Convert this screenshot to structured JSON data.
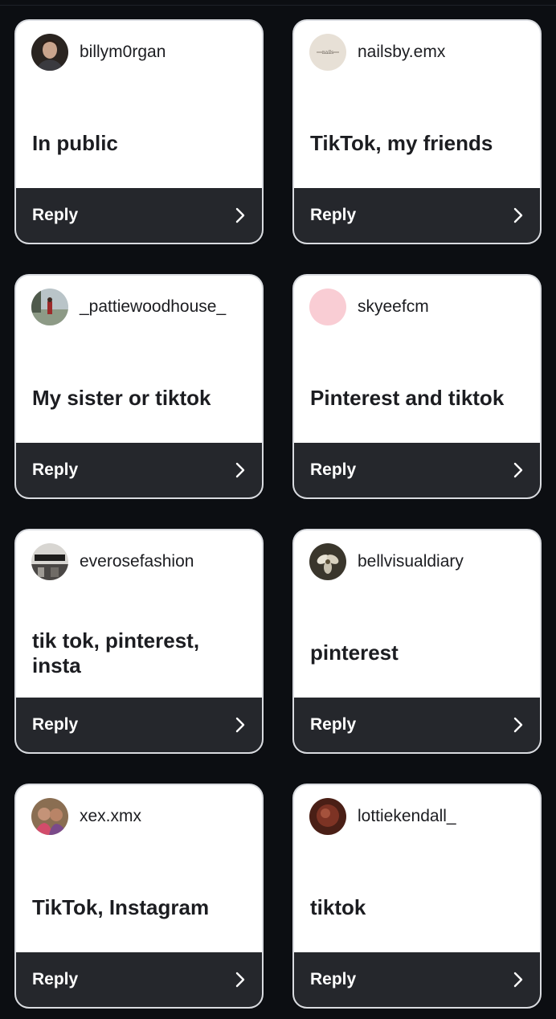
{
  "cards": [
    {
      "username": "billym0rgan",
      "answer": "In public",
      "reply_label": "Reply",
      "avatar_icon": "profile-photo-icon"
    },
    {
      "username": "nailsby.emx",
      "answer": "TikTok, my friends",
      "reply_label": "Reply",
      "avatar_icon": "profile-photo-icon"
    },
    {
      "username": "_pattiewoodhouse_",
      "answer": "My sister or tiktok",
      "reply_label": "Reply",
      "avatar_icon": "profile-photo-icon"
    },
    {
      "username": "skyeefcm",
      "answer": "Pinterest and tiktok",
      "reply_label": "Reply",
      "avatar_icon": "profile-photo-icon"
    },
    {
      "username": "everosefashion",
      "answer": "tik tok, pinterest, insta",
      "reply_label": "Reply",
      "avatar_icon": "profile-photo-icon"
    },
    {
      "username": "bellvisualdiary",
      "answer": "pinterest",
      "reply_label": "Reply",
      "avatar_icon": "profile-photo-icon"
    },
    {
      "username": "xex.xmx",
      "answer": "TikTok, Instagram",
      "reply_label": "Reply",
      "avatar_icon": "profile-photo-icon"
    },
    {
      "username": "lottiekendall_",
      "answer": "tiktok",
      "reply_label": "Reply",
      "avatar_icon": "profile-photo-icon"
    }
  ],
  "colors": {
    "background": "#0c0e12",
    "card": "#ffffff",
    "reply_bar": "#25272c",
    "text": "#1c1d21"
  }
}
